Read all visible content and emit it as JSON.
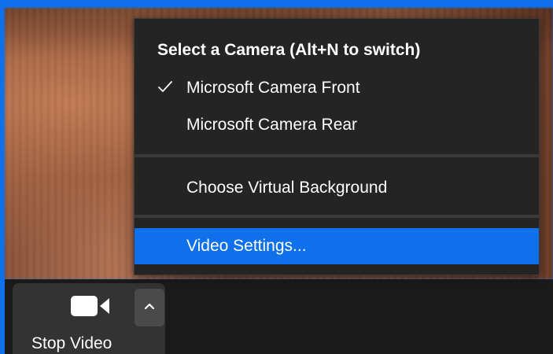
{
  "camera_menu": {
    "header": "Select a Camera (Alt+N to switch)",
    "cameras": [
      {
        "label": "Microsoft Camera Front",
        "selected": true,
        "icon": "checkmark-icon"
      },
      {
        "label": "Microsoft Camera Rear",
        "selected": false
      }
    ],
    "virtual_background_label": "Choose Virtual Background",
    "video_settings_label": "Video Settings...",
    "highlight_color": "#0e71eb"
  },
  "toolbar": {
    "video_button_label": "Stop Video",
    "video_icon": "video-camera-icon",
    "expand_icon": "chevron-up-icon"
  }
}
